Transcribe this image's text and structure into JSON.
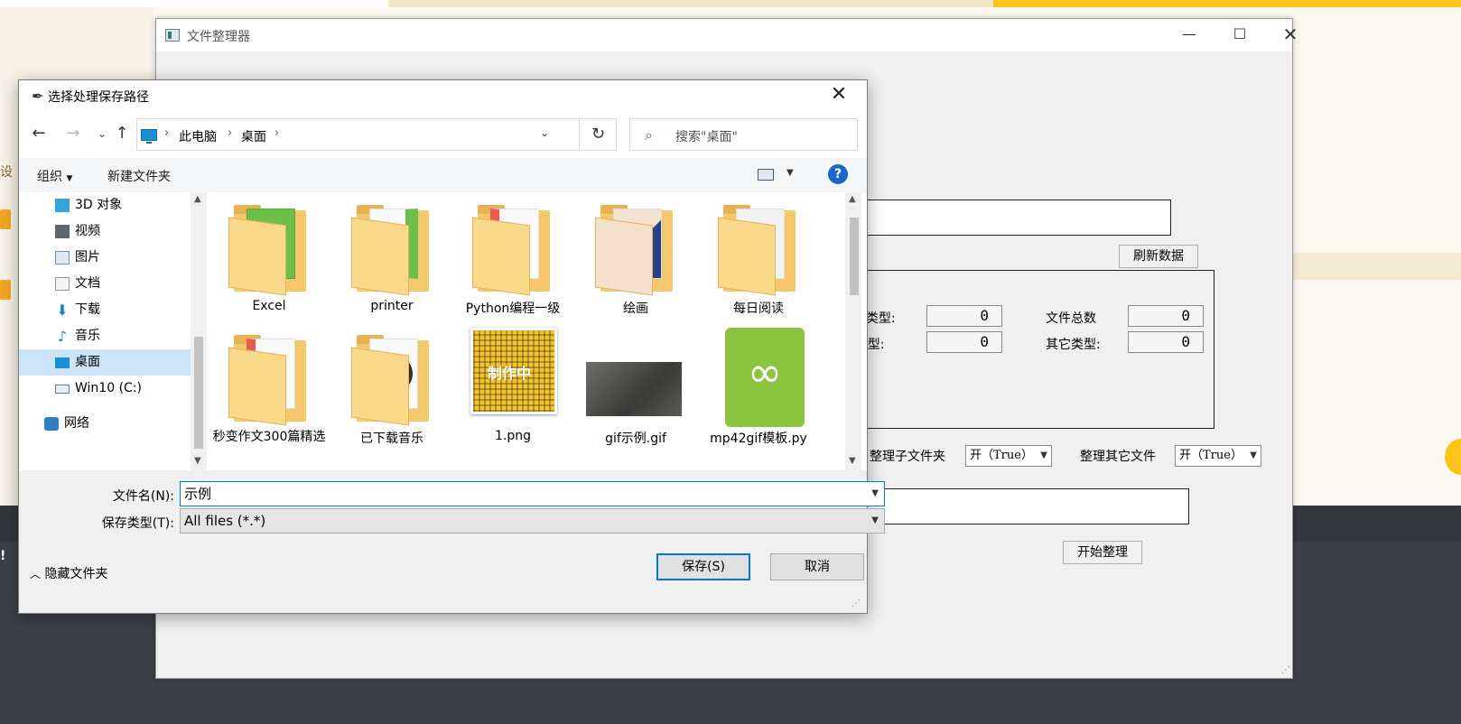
{
  "background": {
    "left_text": "设",
    "exclamation": "!"
  },
  "main_window": {
    "title": "文件整理器",
    "refresh_button": "刷新数据",
    "start_button": "开始整理",
    "stats": [
      {
        "label": "exe类型:",
        "value": "0"
      },
      {
        "label": "文件总数",
        "value": "0"
      },
      {
        "label": "ui类型:",
        "value": "0"
      },
      {
        "label": "其它类型:",
        "value": "0"
      }
    ],
    "options": [
      {
        "label": "整理子文件夹",
        "value": "开（True）"
      },
      {
        "label": "整理其它文件",
        "value": "开（True）"
      }
    ]
  },
  "dialog": {
    "title": "选择处理保存路径",
    "breadcrumbs": [
      "此电脑",
      "桌面"
    ],
    "search_placeholder": "搜索\"桌面\"",
    "toolbar": {
      "organize": "组织",
      "new_folder": "新建文件夹",
      "help": "?"
    },
    "nav_items": [
      {
        "label": "3D 对象",
        "icon": "3d-objects-icon",
        "color": "#36a3d9"
      },
      {
        "label": "视频",
        "icon": "video-icon",
        "color": "#5a6670"
      },
      {
        "label": "图片",
        "icon": "pictures-icon",
        "color": "#6a8fb5"
      },
      {
        "label": "文档",
        "icon": "documents-icon",
        "color": "#8c9aa6"
      },
      {
        "label": "下载",
        "icon": "downloads-icon",
        "color": "#1b7fd1"
      },
      {
        "label": "音乐",
        "icon": "music-icon",
        "color": "#1b7fd1"
      },
      {
        "label": "桌面",
        "icon": "desktop-icon",
        "color": "#1a8fd9"
      },
      {
        "label": "Win10 (C:)",
        "icon": "drive-icon",
        "color": "#6a7e90"
      },
      {
        "label": "网络",
        "icon": "network-icon",
        "color": "#2c7fc1"
      }
    ],
    "files": [
      {
        "name": "Excel",
        "kind": "folder",
        "accent": "#6cc04a"
      },
      {
        "name": "printer",
        "kind": "folder",
        "accent": "#6cc04a"
      },
      {
        "name": "Python编程一级",
        "kind": "folder",
        "accent": "#e85a4f"
      },
      {
        "name": "绘画",
        "kind": "folder",
        "accent": "#27408b"
      },
      {
        "name": "每日阅读",
        "kind": "folder",
        "accent": "#999999"
      },
      {
        "name": "秒变作文300篇精选",
        "kind": "folder",
        "accent": "#e85a4f"
      },
      {
        "name": "已下载音乐",
        "kind": "folder",
        "accent": "#e8733a"
      },
      {
        "name": "1.png",
        "kind": "image",
        "accent": "#f2c230",
        "caption": "制作中"
      },
      {
        "name": "gif示例.gif",
        "kind": "photo",
        "accent": "#4a4a48"
      },
      {
        "name": "mp42gif模板.py",
        "kind": "python",
        "accent": "#8bc53f"
      }
    ],
    "filename_label": "文件名(N):",
    "filename_value": "示例",
    "filetype_label": "保存类型(T):",
    "filetype_value": "All files (*.*)",
    "hide_folders": "隐藏文件夹",
    "save_button": "保存(S)",
    "cancel_button": "取消"
  }
}
